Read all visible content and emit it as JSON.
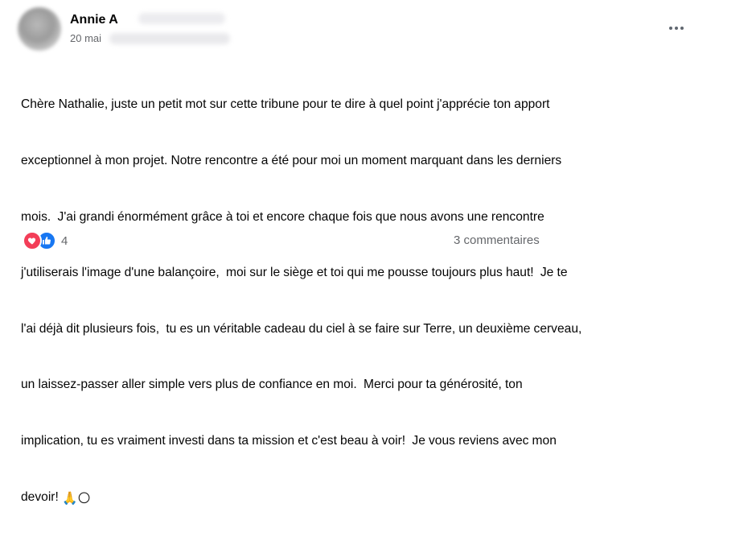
{
  "post": {
    "author": "Annie A",
    "date": "20 mai",
    "options_icon": "more-options-icon",
    "message_lines": [
      "Chère Nathalie, juste un petit mot sur cette tribune pour te dire à quel point j'apprécie ton apport",
      "exceptionnel à mon projet. Notre rencontre a été pour moi un moment marquant dans les derniers",
      "mois.  J'ai grandi énormément grâce à toi et encore chaque fois que nous avons une rencontre",
      "j'utiliserais l'image d'une balançoire,  moi sur le siège et toi qui me pousse toujours plus haut!  Je te",
      "l'ai déjà dit plusieurs fois,  tu es un véritable cadeau du ciel à se faire sur Terre, un deuxième cerveau,",
      "un laissez-passer aller simple vers plus de confiance en moi.  Merci pour ta générosité, ton",
      "implication, tu es vraiment investi dans ta mission et c'est beau à voir!  Je vous reviens avec mon",
      "devoir! "
    ],
    "emojis": "🙏🌕",
    "reactions": {
      "icons": [
        "love-reaction-icon",
        "like-reaction-icon"
      ],
      "count": "4"
    },
    "comments_label": "3 commentaires"
  },
  "colors": {
    "love": "#f33e58",
    "like": "#1877f2",
    "secondary_text": "#65676b",
    "primary_text": "#050505"
  }
}
